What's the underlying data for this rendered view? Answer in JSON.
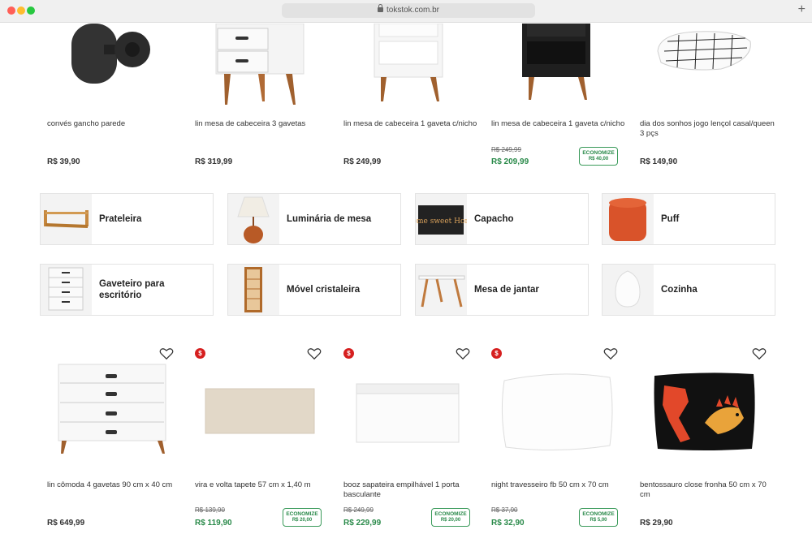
{
  "browser": {
    "url": "tokstok.com.br",
    "new_tab_label": "+"
  },
  "top_products": [
    {
      "name": "convés gancho parede",
      "price": "R$ 39,90"
    },
    {
      "name": "lin mesa de cabeceira 3 gavetas",
      "price": "R$ 319,99"
    },
    {
      "name": "lin mesa de cabeceira 1 gaveta c/nicho",
      "price": "R$ 249,99"
    },
    {
      "name": "lin mesa de cabeceira 1 gaveta c/nicho",
      "old_price": "R$ 249,99",
      "price": "R$ 209,99",
      "save_label": "ECONOMIZE",
      "save_value": "R$ 40,00"
    },
    {
      "name": "dia dos sonhos jogo lençol casal/queen 3 pçs",
      "price": "R$ 149,90"
    }
  ],
  "categories": [
    {
      "label": "Prateleira"
    },
    {
      "label": "Luminária de mesa"
    },
    {
      "label": "Capacho"
    },
    {
      "label": "Puff"
    },
    {
      "label": "Gaveteiro para escritório"
    },
    {
      "label": "Móvel cristaleira"
    },
    {
      "label": "Mesa de jantar"
    },
    {
      "label": "Cozinha"
    }
  ],
  "capacho_mat_text": "Home sweet Home",
  "bottom_products": [
    {
      "name": "lin cômoda 4 gavetas 90 cm x 40 cm",
      "price": "R$ 649,99"
    },
    {
      "name": "vira e volta tapete 57 cm x 1,40 m",
      "old_price": "R$ 139,90",
      "price": "R$ 119,90",
      "save_label": "ECONOMIZE",
      "save_value": "R$ 20,00",
      "promo_badge": "$"
    },
    {
      "name": "booz sapateira empilhável 1 porta basculante",
      "old_price": "R$ 249,99",
      "price": "R$ 229,99",
      "save_label": "ECONOMIZE",
      "save_value": "R$ 20,00",
      "promo_badge": "$"
    },
    {
      "name": "night travesseiro fb 50 cm x 70 cm",
      "old_price": "R$ 37,90",
      "price": "R$ 32,90",
      "save_label": "ECONOMIZE",
      "save_value": "R$ 5,00",
      "promo_badge": "$"
    },
    {
      "name": "bentossauro close fronha 50 cm x 70 cm",
      "price": "R$ 29,90"
    }
  ],
  "icons": {
    "favorite": "heart-outline-icon",
    "promo": "dollar-badge-icon",
    "lock": "lock-icon"
  },
  "colors": {
    "sale_green": "#2a8a4a",
    "promo_red": "#d61f1f"
  }
}
